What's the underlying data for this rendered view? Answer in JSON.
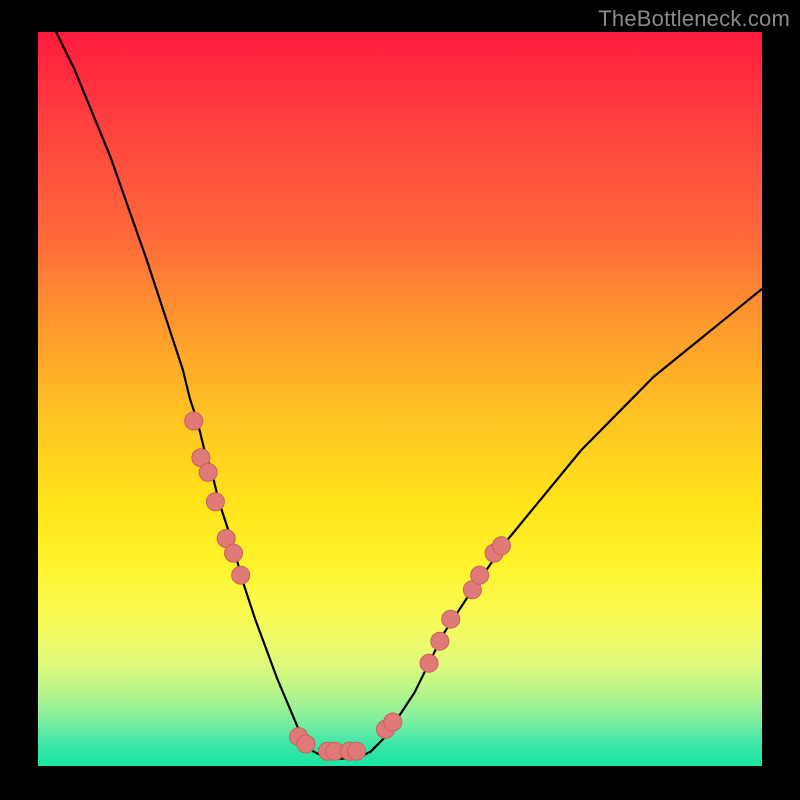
{
  "watermark": "TheBottleneck.com",
  "colors": {
    "curve_stroke": "#000000",
    "marker_fill": "#e07a78",
    "marker_stroke": "#c85f5d"
  },
  "chart_data": {
    "type": "line",
    "title": "",
    "xlabel": "",
    "ylabel": "",
    "xlim": [
      0,
      100
    ],
    "ylim": [
      0,
      100
    ],
    "grid": false,
    "series": [
      {
        "name": "bottleneck-curve",
        "x": [
          0,
          5,
          10,
          15,
          20,
          21,
          22,
          23,
          24,
          25,
          26,
          27,
          28,
          30,
          33,
          36,
          38,
          40,
          42,
          44,
          46,
          48,
          50,
          52,
          54,
          56,
          60,
          65,
          70,
          75,
          80,
          85,
          90,
          95,
          100
        ],
        "values": [
          105,
          95,
          83,
          69,
          54,
          50,
          47,
          43,
          40,
          36,
          33,
          30,
          26,
          20,
          12,
          5,
          2,
          1,
          1,
          1,
          2,
          4,
          7,
          10,
          14,
          18,
          24,
          31,
          37,
          43,
          48,
          53,
          57,
          61,
          65
        ]
      }
    ],
    "markers": {
      "name": "highlight-dots",
      "points": [
        {
          "x": 21.5,
          "y": 47
        },
        {
          "x": 22.5,
          "y": 42
        },
        {
          "x": 23.5,
          "y": 40
        },
        {
          "x": 24.5,
          "y": 36
        },
        {
          "x": 26.0,
          "y": 31
        },
        {
          "x": 27.0,
          "y": 29
        },
        {
          "x": 28.0,
          "y": 26
        },
        {
          "x": 36.0,
          "y": 4
        },
        {
          "x": 37.0,
          "y": 3
        },
        {
          "x": 40.0,
          "y": 2
        },
        {
          "x": 41.0,
          "y": 2
        },
        {
          "x": 43.0,
          "y": 2
        },
        {
          "x": 44.0,
          "y": 2
        },
        {
          "x": 48.0,
          "y": 5
        },
        {
          "x": 49.0,
          "y": 6
        },
        {
          "x": 54.0,
          "y": 14
        },
        {
          "x": 55.5,
          "y": 17
        },
        {
          "x": 57.0,
          "y": 20
        },
        {
          "x": 60.0,
          "y": 24
        },
        {
          "x": 61.0,
          "y": 26
        },
        {
          "x": 63.0,
          "y": 29
        },
        {
          "x": 64.0,
          "y": 30
        }
      ]
    }
  }
}
